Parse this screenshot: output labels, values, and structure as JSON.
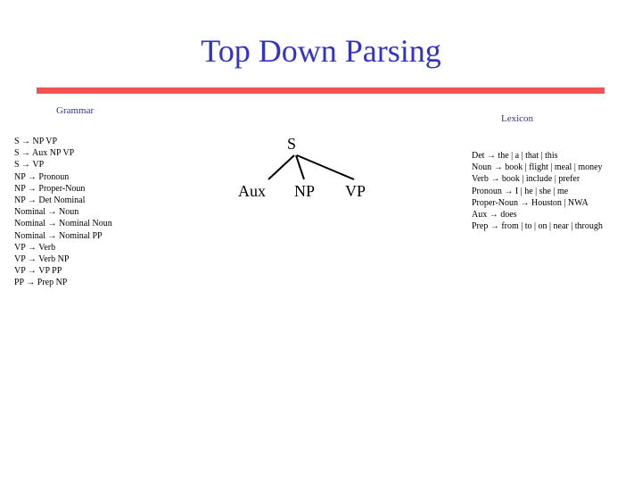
{
  "slide": {
    "title": "Top Down Parsing",
    "accent_color": "#f25252",
    "title_color": "#3333cc"
  },
  "grammar": {
    "heading": "Grammar",
    "rules": [
      "S → NP VP",
      "S → Aux NP VP",
      "S → VP",
      "NP → Pronoun",
      "NP → Proper-Noun",
      "NP → Det Nominal",
      "Nominal → Noun",
      "Nominal → Nominal Noun",
      "Nominal → Nominal PP",
      "VP → Verb",
      "VP → Verb NP",
      "VP → VP PP",
      "PP → Prep NP"
    ]
  },
  "tree": {
    "root": "S",
    "children": [
      "Aux",
      "NP",
      "VP"
    ]
  },
  "lexicon": {
    "heading": "Lexicon",
    "entries": [
      "Det → the | a | that | this",
      "Noun → book | flight | meal | money",
      "Verb → book | include | prefer",
      "Pronoun → I | he | she | me",
      "Proper-Noun → Houston | NWA",
      "Aux → does",
      "Prep → from | to | on | near | through"
    ]
  }
}
